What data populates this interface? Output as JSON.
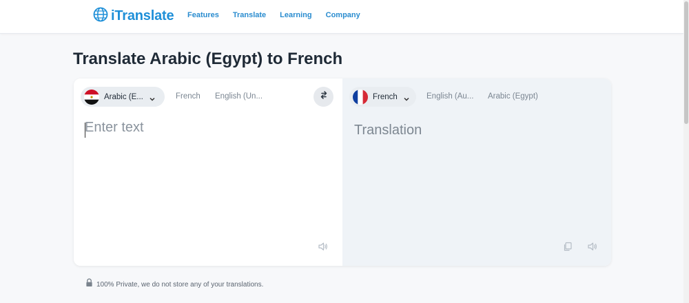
{
  "brand": {
    "name": "iTranslate",
    "color": "#1e8fd8"
  },
  "nav": {
    "items": [
      "Features",
      "Translate",
      "Learning",
      "Company"
    ]
  },
  "page": {
    "title": "Translate Arabic (Egypt) to French"
  },
  "source": {
    "selected_label": "Arabic (E...",
    "flag": "egypt-flag",
    "options": [
      "French",
      "English (Un..."
    ],
    "input_value": "",
    "input_placeholder": "Enter text"
  },
  "target": {
    "selected_label": "French",
    "flag": "france-flag",
    "options": [
      "English (Au...",
      "Arabic (Egypt)"
    ],
    "output_placeholder": "Translation"
  },
  "footer": {
    "privacy_text": "100% Private, we do not store any of your translations."
  },
  "icons": {
    "logo": "globe-icon",
    "swap": "swap-icon",
    "speaker": "speaker-icon",
    "copy": "copy-icon",
    "lock": "lock-icon",
    "chevron": "chevron-down-icon"
  }
}
